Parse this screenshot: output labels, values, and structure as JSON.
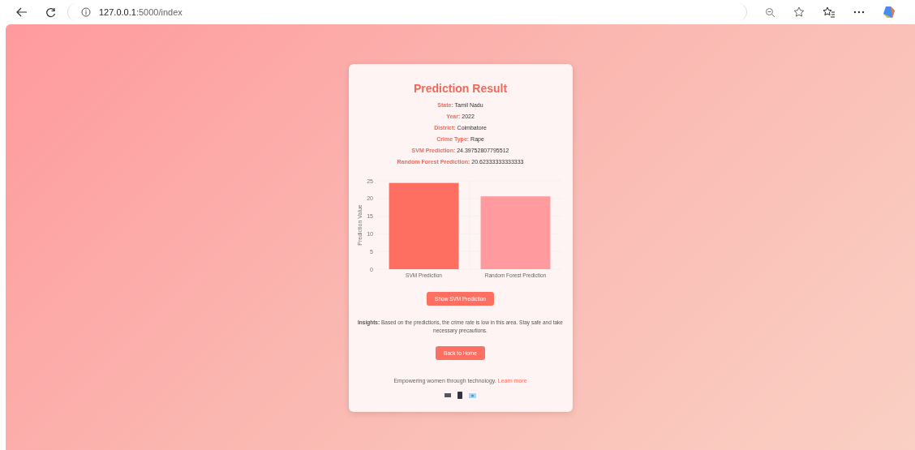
{
  "browser": {
    "url_host": "127.0.0.1",
    "url_path": ":5000/index"
  },
  "card": {
    "title": "Prediction Result",
    "fields": [
      {
        "label": "State:",
        "value": "Tamil Nadu"
      },
      {
        "label": "Year:",
        "value": "2022"
      },
      {
        "label": "District:",
        "value": "Coimbatore"
      },
      {
        "label": "Crime Type:",
        "value": "Rape"
      },
      {
        "label": "SVM Prediction:",
        "value": "24.39752807795512"
      },
      {
        "label": "Random Forest Prediction:",
        "value": "20.62333333333333"
      }
    ],
    "chart_data": {
      "type": "bar",
      "ylabel": "Prediction Value",
      "categories": [
        null,
        null
      ],
      "series": [
        {
          "name": "SVM Prediction",
          "color": "#ff6f61",
          "values": [
            24.4,
            null
          ]
        },
        {
          "name": "Random Forest Prediction",
          "color": "#ff9a9e",
          "values": [
            null,
            20.6
          ]
        }
      ],
      "stacked": true,
      "grid": true,
      "ylim": [
        0,
        25
      ],
      "yticks": [
        0,
        5,
        10,
        15,
        20,
        25
      ]
    },
    "show_button": "Show SVM Prediction",
    "insights": "**Insights:** Based on the predictions, the crime rate is low in this area. Stay safe and take necessary precautions.",
    "back_button": "Back to Home",
    "footer_text": "Empowering women through technology.",
    "footer_link": "Learn more"
  }
}
